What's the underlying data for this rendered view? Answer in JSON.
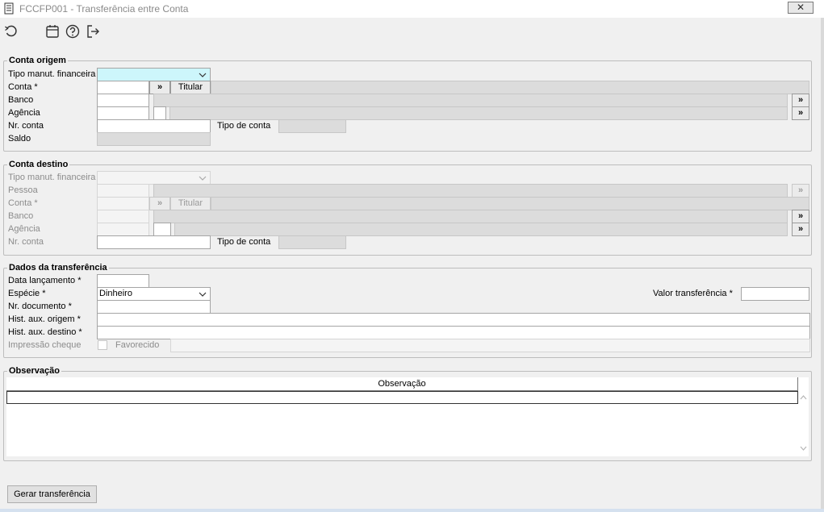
{
  "window": {
    "title": "FCCFP001 - Transferência entre Conta",
    "close_symbol": "✕"
  },
  "toolbar": {
    "icons": [
      "refresh-icon",
      "calendar-icon",
      "help-icon",
      "exit-icon"
    ]
  },
  "origem": {
    "legend": "Conta origem",
    "tipo_label": "Tipo manut. financeira",
    "conta_label": "Conta *",
    "banco_label": "Banco",
    "agencia_label": "Agência",
    "nrconta_label": "Nr. conta",
    "tipoconta_label": "Tipo de conta",
    "saldo_label": "Saldo",
    "titular_label": "Titular",
    "lookup_symbol": "»"
  },
  "destino": {
    "legend": "Conta destino",
    "tipo_label": "Tipo manut. financeira",
    "pessoa_label": "Pessoa",
    "conta_label": "Conta *",
    "banco_label": "Banco",
    "agencia_label": "Agência",
    "nrconta_label": "Nr. conta",
    "tipoconta_label": "Tipo de conta",
    "titular_label": "Titular",
    "lookup_symbol": "»"
  },
  "transferencia": {
    "legend": "Dados da transferência",
    "data_label": "Data lançamento *",
    "especie_label": "Espécie *",
    "especie_value": "Dinheiro",
    "valor_label": "Valor transferência *",
    "nrdoc_label": "Nr. documento *",
    "hist_origem_label": "Hist. aux. origem *",
    "hist_destino_label": "Hist. aux. destino *",
    "impressao_label": "Impressão cheque",
    "favorecido_label": "Favorecido"
  },
  "observacao": {
    "legend": "Observação",
    "column_header": "Observação"
  },
  "footer": {
    "gerar_button": "Gerar transferência"
  }
}
